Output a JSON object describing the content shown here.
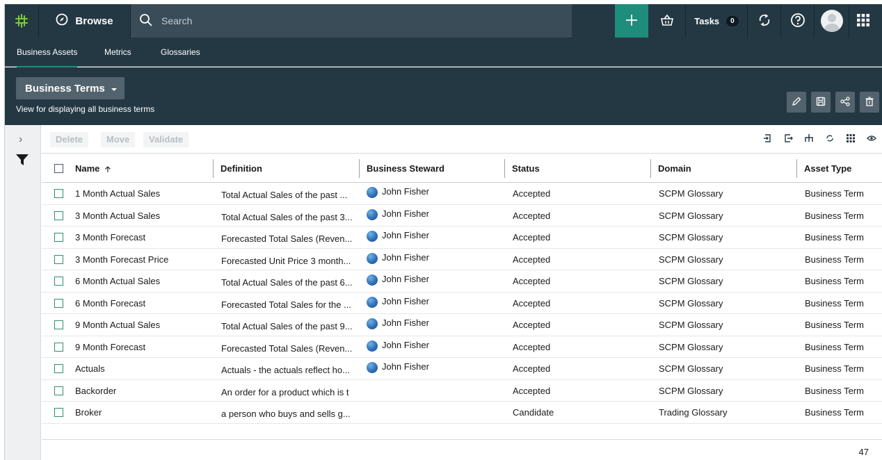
{
  "topbar": {
    "browse_label": "Browse",
    "search_placeholder": "Search",
    "tasks_label": "Tasks",
    "tasks_count": "0",
    "icons": [
      "logo-icon",
      "compass-icon",
      "search-icon",
      "plus-icon",
      "basket-icon",
      "sync-icon",
      "help-icon",
      "avatar",
      "apps-grid-icon"
    ]
  },
  "subnav": {
    "tabs": [
      {
        "label": "Business Assets",
        "active": true
      },
      {
        "label": "Metrics",
        "active": false
      },
      {
        "label": "Glossaries",
        "active": false
      }
    ]
  },
  "view": {
    "title": "Business Terms",
    "description": "View for displaying all business terms",
    "actions": [
      "edit-icon",
      "save-icon",
      "share-icon",
      "delete-icon"
    ]
  },
  "toolbar": {
    "delete_label": "Delete",
    "move_label": "Move",
    "validate_label": "Validate"
  },
  "table": {
    "columns": {
      "name": "Name",
      "definition": "Definition",
      "steward": "Business Steward",
      "status": "Status",
      "domain": "Domain",
      "asset_type": "Asset Type"
    },
    "rows": [
      {
        "name": "1 Month Actual Sales",
        "definition": "Total Actual Sales of the past ...",
        "steward": "John Fisher",
        "status": "Accepted",
        "domain": "SCPM Glossary",
        "asset_type": "Business Term"
      },
      {
        "name": "3 Month Actual Sales",
        "definition": "Total Actual Sales of the past 3...",
        "steward": "John Fisher",
        "status": "Accepted",
        "domain": "SCPM Glossary",
        "asset_type": "Business Term"
      },
      {
        "name": "3 Month Forecast",
        "definition": "Forecasted Total Sales (Reven...",
        "steward": "John Fisher",
        "status": "Accepted",
        "domain": "SCPM Glossary",
        "asset_type": "Business Term"
      },
      {
        "name": "3 Month Forecast Price",
        "definition": "Forecasted Unit Price 3 month...",
        "steward": "John Fisher",
        "status": "Accepted",
        "domain": "SCPM Glossary",
        "asset_type": "Business Term"
      },
      {
        "name": "6 Month Actual Sales",
        "definition": "Total Actual Sales of the past 6...",
        "steward": "John Fisher",
        "status": "Accepted",
        "domain": "SCPM Glossary",
        "asset_type": "Business Term"
      },
      {
        "name": "6 Month Forecast",
        "definition": "Forecasted Total Sales for the ...",
        "steward": "John Fisher",
        "status": "Accepted",
        "domain": "SCPM Glossary",
        "asset_type": "Business Term"
      },
      {
        "name": "9 Month Actual Sales",
        "definition": "Total Actual Sales of the past 9...",
        "steward": "John Fisher",
        "status": "Accepted",
        "domain": "SCPM Glossary",
        "asset_type": "Business Term"
      },
      {
        "name": "9 Month Forecast",
        "definition": "Forecasted Total Sales (Reven...",
        "steward": "John Fisher",
        "status": "Accepted",
        "domain": "SCPM Glossary",
        "asset_type": "Business Term"
      },
      {
        "name": "Actuals",
        "definition": "Actuals - the actuals reflect ho...",
        "steward": "John Fisher",
        "status": "Accepted",
        "domain": "SCPM Glossary",
        "asset_type": "Business Term"
      },
      {
        "name": "Backorder",
        "definition": "An order for a product which is t",
        "steward": "",
        "status": "Accepted",
        "domain": "SCPM Glossary",
        "asset_type": "Business Term"
      },
      {
        "name": "Broker",
        "definition": "a person who buys and sells g...",
        "steward": "",
        "status": "Candidate",
        "domain": "Trading Glossary",
        "asset_type": "Business Term"
      }
    ]
  },
  "footer": {
    "total_count": "47"
  },
  "colors": {
    "topbar_bg": "#243844",
    "accent": "#1f8d7c",
    "button_bg": "#52636d"
  }
}
